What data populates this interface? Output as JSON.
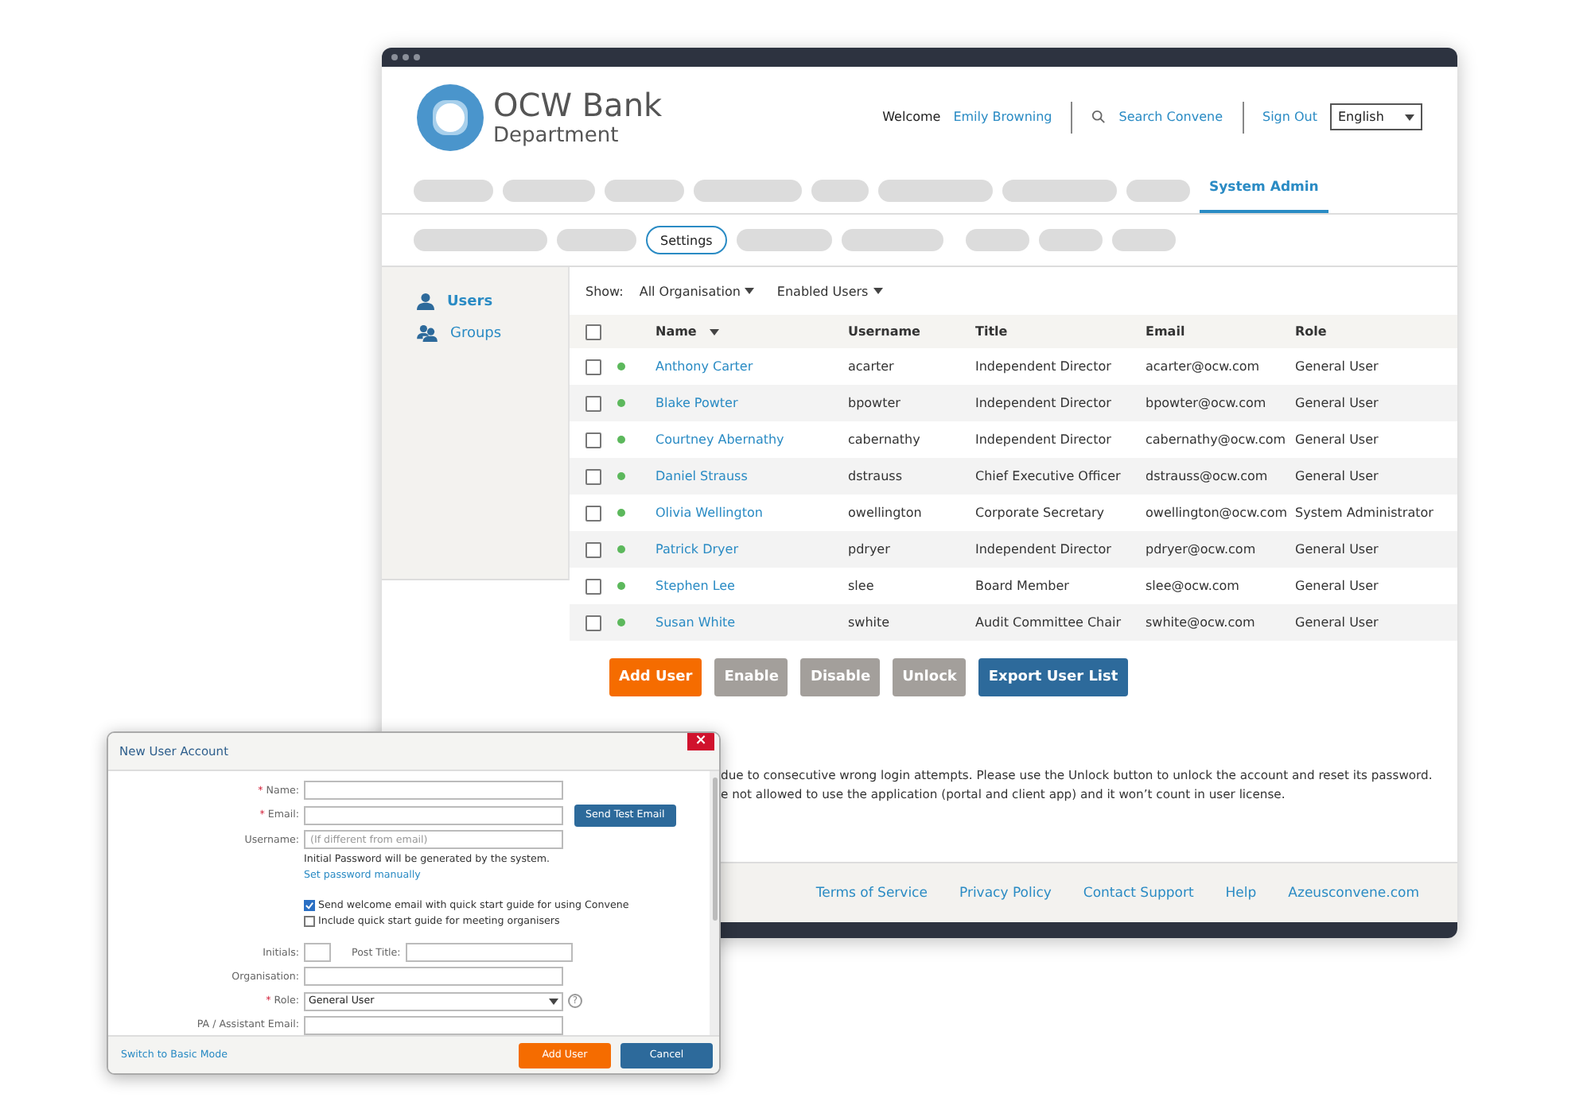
{
  "app": {
    "org_name": "OCW Bank",
    "org_unit": "Department"
  },
  "header": {
    "welcome": "Welcome",
    "user": "Emily Browning",
    "search": "Search Convene",
    "sign_out": "Sign Out",
    "language": "English"
  },
  "nav": {
    "tabs": [
      {
        "label": "System Admin",
        "selected": true
      }
    ]
  },
  "subnav": {
    "tabs": [
      {
        "label": "Settings",
        "selected": true
      }
    ]
  },
  "sidebar": {
    "items": [
      {
        "label": "Users",
        "kind": "user",
        "selected": true
      },
      {
        "label": "Groups",
        "kind": "group",
        "selected": false
      }
    ]
  },
  "filters": {
    "show_label": "Show:",
    "organisation": "All Organisation",
    "status": "Enabled Users"
  },
  "table": {
    "all_checked": false,
    "columns": [
      "Name",
      "Username",
      "Title",
      "Email",
      "Role"
    ],
    "rows": [
      {
        "name": "Anthony Carter",
        "username": "acarter",
        "title": "Independent Director",
        "email": "acarter@ocw.com",
        "role": "General User",
        "checked": false,
        "enabled": true
      },
      {
        "name": "Blake Powter",
        "username": "bpowter",
        "title": "Independent Director",
        "email": "bpowter@ocw.com",
        "role": "General User",
        "checked": false,
        "enabled": true
      },
      {
        "name": "Courtney Abernathy",
        "username": "cabernathy",
        "title": "Independent Director",
        "email": "cabernathy@ocw.com",
        "role": "General User",
        "checked": false,
        "enabled": true
      },
      {
        "name": "Daniel Strauss",
        "username": "dstrauss",
        "title": "Chief Executive Officer",
        "email": "dstrauss@ocw.com",
        "role": "General User",
        "checked": false,
        "enabled": true
      },
      {
        "name": "Olivia Wellington",
        "username": "owellington",
        "title": "Corporate Secretary",
        "email": "owellington@ocw.com",
        "role": "System Administrator",
        "checked": false,
        "enabled": true
      },
      {
        "name": "Patrick Dryer",
        "username": "pdryer",
        "title": "Independent Director",
        "email": "pdryer@ocw.com",
        "role": "General User",
        "checked": false,
        "enabled": true
      },
      {
        "name": "Stephen Lee",
        "username": "slee",
        "title": "Board Member",
        "email": "slee@ocw.com",
        "role": "General User",
        "checked": false,
        "enabled": true
      },
      {
        "name": "Susan White",
        "username": "swhite",
        "title": "Audit Committee Chair",
        "email": "swhite@ocw.com",
        "role": "General User",
        "checked": false,
        "enabled": true
      }
    ]
  },
  "actions": [
    {
      "label": "Add User",
      "kind": "primary"
    },
    {
      "label": "Enable",
      "kind": "muted"
    },
    {
      "label": "Disable",
      "kind": "muted"
    },
    {
      "label": "Unlock",
      "kind": "muted"
    },
    {
      "label": "Export User List",
      "kind": "secondary"
    }
  ],
  "notes": [
    "due to consecutive wrong login attempts. Please use the Unlock button to unlock the account and reset its password.",
    "e not allowed to use the application (portal and client app) and it won’t count in user license."
  ],
  "footer": {
    "links": [
      "Terms of Service",
      "Privacy Policy",
      "Contact Support",
      "Help",
      "Azeusconvene.com"
    ]
  },
  "dialog": {
    "title": "New User Account",
    "close": "×",
    "required_mark": "*",
    "fields": [
      {
        "label": "Name:",
        "required": true,
        "kind": "input"
      },
      {
        "label": "Email:",
        "required": true,
        "kind": "input",
        "button": "Send Test Email"
      },
      {
        "label": "Username:",
        "required": false,
        "kind": "input",
        "placeholder": "(If different from email)"
      }
    ],
    "password_note": "Initial Password will be generated by the system.",
    "password_link": "Set password manually",
    "options": [
      {
        "label": "Send welcome email with quick start guide for using Convene",
        "checked": true
      },
      {
        "label": "Include quick start guide for meeting organisers",
        "checked": false
      }
    ],
    "initials_label": "Initials:",
    "post_title_label": "Post Title:",
    "more_fields": [
      {
        "label": "Organisation:",
        "required": false,
        "kind": "input"
      },
      {
        "label": "Role:",
        "required": true,
        "kind": "select",
        "value": "General User",
        "help": "?"
      },
      {
        "label": "PA / Assistant Email:",
        "required": false,
        "kind": "input"
      }
    ],
    "mode_link": "Switch to Basic Mode",
    "buttons": [
      {
        "label": "Add User",
        "kind": "primary"
      },
      {
        "label": "Cancel",
        "kind": "secondary"
      }
    ]
  }
}
